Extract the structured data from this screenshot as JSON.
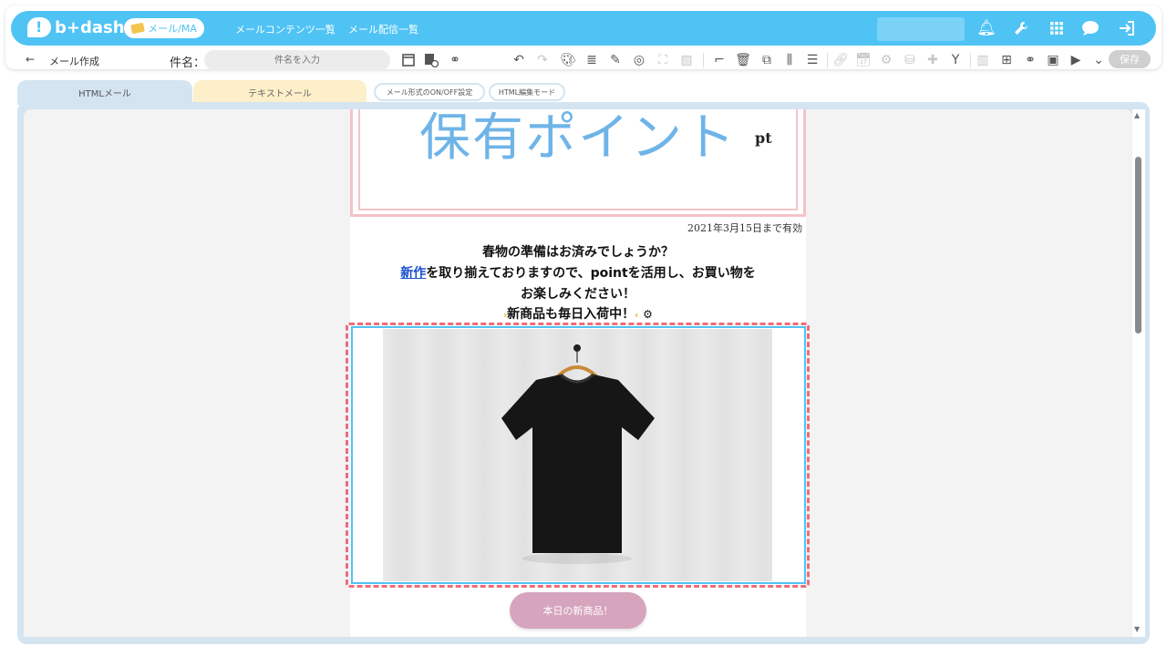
{
  "app": {
    "brand": "b+dash",
    "mail_pill": "メール/MA",
    "nav": [
      "メールコンテンツ一覧",
      "メール配信一覧"
    ]
  },
  "toolbar": {
    "back": "←",
    "page_title": "メール作成",
    "subject_label": "件名：",
    "subject_placeholder": "件名を入力",
    "save_label": "保存"
  },
  "tabs": {
    "html_mail": "HTMLメール",
    "text_mail": "テキストメール",
    "toggle_format": "メール形式のON/OFF設定",
    "html_edit_mode": "HTML編集モード"
  },
  "email": {
    "point_title": "保有ポイント",
    "point_unit": "pt",
    "valid_until": "2021年3月15日まで有効",
    "line1": "春物の準備はお済みでしょうか？",
    "line2_link": "新作",
    "line2_rest": "を取り揃えておりますので、pointを活用し、お買い物を",
    "line3": "お楽しみください！",
    "line4": "新商品も毎日入荷中！",
    "button_label": "本日の新商品！"
  },
  "colors": {
    "topbar": "#4fc3f4",
    "selection_border": "#f06b78",
    "accent_button": "#d6a4bd"
  }
}
